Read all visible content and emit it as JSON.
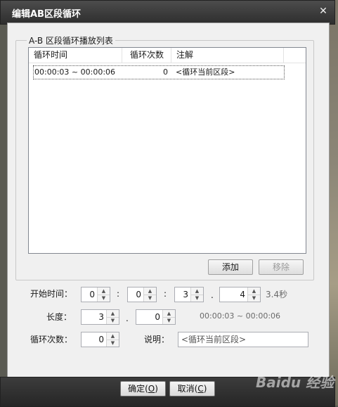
{
  "dialog": {
    "title": "编辑AB区段循环",
    "close_glyph": "✕"
  },
  "group": {
    "title": "A-B 区段循环播放列表"
  },
  "list": {
    "columns": [
      "循环时间",
      "循环次数",
      "注解"
    ],
    "rows": [
      {
        "time": "00:00:03 ~ 00:00:06",
        "count": "0",
        "note": "<循环当前区段>"
      }
    ]
  },
  "buttons": {
    "add": "添加",
    "remove": "移除"
  },
  "form": {
    "start_label": "开始时间：",
    "start": {
      "h": "0",
      "m": "0",
      "s": "3",
      "frac": "4"
    },
    "colon": ":",
    "dot": ".",
    "seconds_text": "3.4秒",
    "length_label": "长度：",
    "length": {
      "s": "3",
      "frac": "0"
    },
    "range_text": "00:00:03 ~ 00:00:06",
    "loop_label": "循环次数：",
    "loop_count": "0",
    "note_label": "说明：",
    "note_value": "<循环当前区段>"
  },
  "footer": {
    "ok_prefix": "确定(",
    "ok_key": "O",
    "ok_suffix": ")",
    "cancel_prefix": "取消(",
    "cancel_key": "C",
    "cancel_suffix": ")"
  },
  "watermark": "Baidu 经验"
}
